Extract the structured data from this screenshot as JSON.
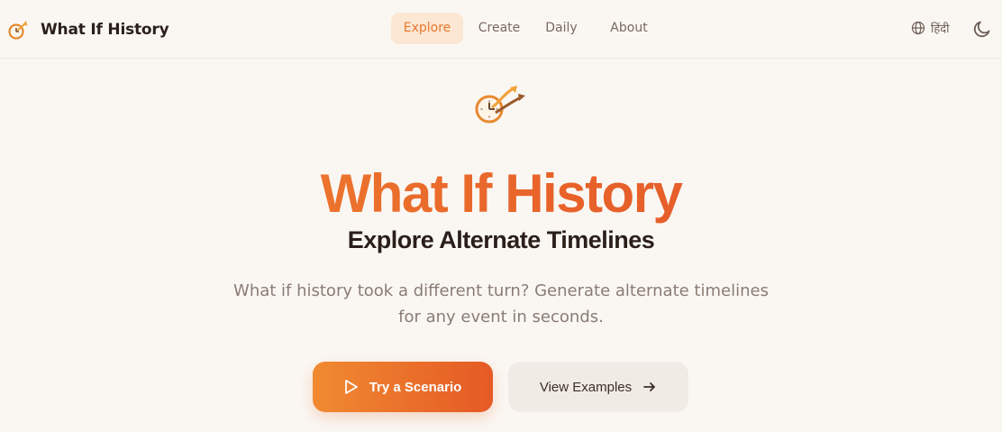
{
  "header": {
    "brand_name": "What If History",
    "nav": [
      {
        "label": "Explore",
        "active": true
      },
      {
        "label": "Create",
        "active": false
      },
      {
        "label": "Daily",
        "active": false
      },
      {
        "label": "About",
        "active": false
      }
    ],
    "language_label": "हिंदी",
    "icons": {
      "brand": "clock-arrow-logo-icon",
      "language": "globe-icon",
      "theme": "moon-icon"
    }
  },
  "hero": {
    "icon": "clock-arrow-logo-icon",
    "title": "What If History",
    "subtitle": "Explore Alternate Timelines",
    "description": "What if history took a different turn? Generate alternate timelines for any event in seconds.",
    "primary_button": {
      "label": "Try a Scenario",
      "icon": "play-icon"
    },
    "secondary_button": {
      "label": "View Examples",
      "icon": "arrow-right-icon"
    }
  },
  "colors": {
    "accent": "#e8772e",
    "accent_dark": "#e0542a",
    "background": "#faf7f3",
    "nav_active_bg": "#fbe7d3",
    "text_dark": "#2b1f1a",
    "text_muted": "#8a7c74",
    "secondary_button_bg": "#f1ebe5"
  }
}
